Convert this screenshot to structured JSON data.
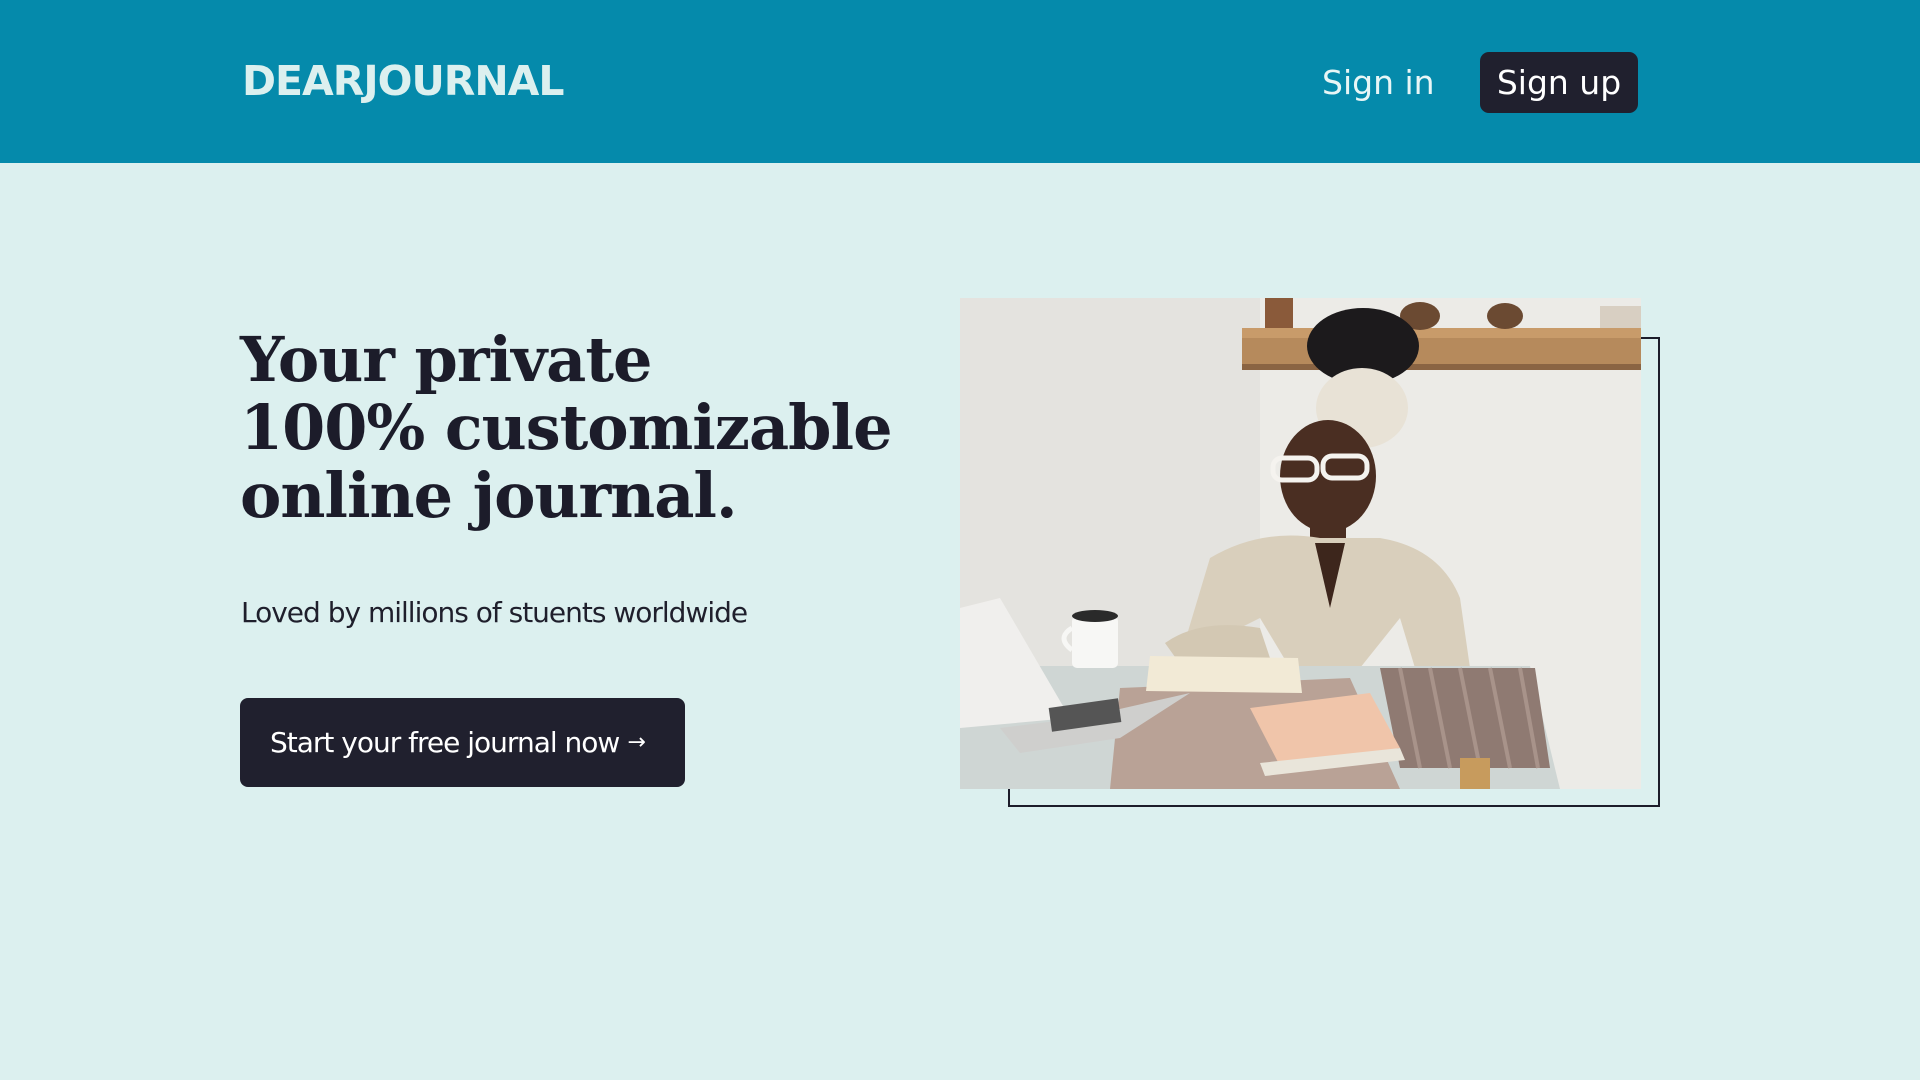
{
  "header": {
    "logo_text": "DEARJOURNAL",
    "signin_label": "Sign in",
    "signup_label": "Sign up"
  },
  "hero": {
    "headline_lines": [
      "Your private",
      "100% customizable",
      "online journal."
    ],
    "subtitle": "Loved by millions of stuents worldwide",
    "cta_label": "Start your free journal now",
    "cta_arrow": "→"
  },
  "colors": {
    "header_bg": "#058aab",
    "page_bg": "#dcf0ef",
    "dark_button": "#20202e",
    "headline_text": "#1c1c2a"
  }
}
